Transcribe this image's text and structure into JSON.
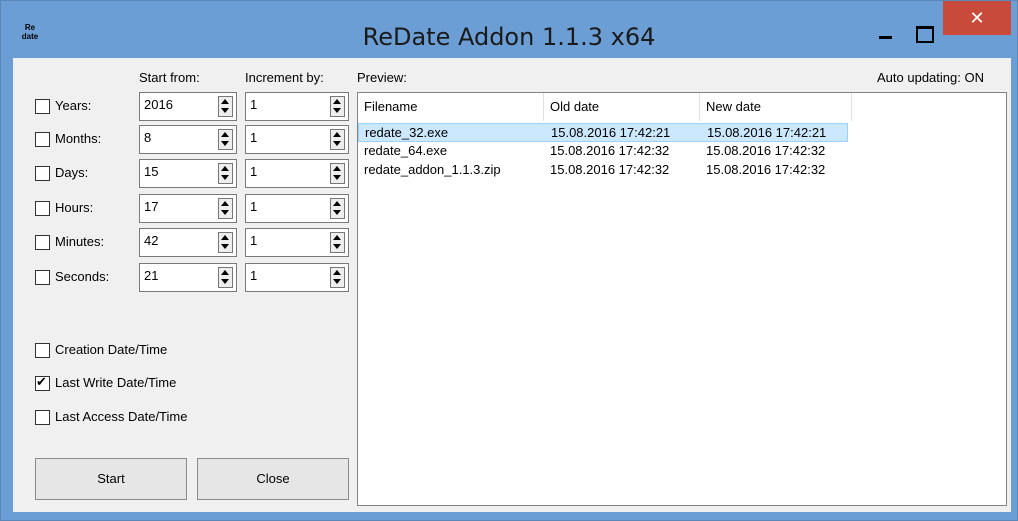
{
  "window": {
    "icon_text": "Re date",
    "title": "ReDate Addon 1.1.3 x64",
    "close_glyph": "✕"
  },
  "headers": {
    "start_from": "Start from:",
    "increment_by": "Increment by:",
    "preview": "Preview:",
    "auto_updating": "Auto updating: ON"
  },
  "fields": [
    {
      "label": "Years:",
      "start": "2016",
      "increment": "1",
      "checked": false
    },
    {
      "label": "Months:",
      "start": "8",
      "increment": "1",
      "checked": false
    },
    {
      "label": "Days:",
      "start": "15",
      "increment": "1",
      "checked": false
    },
    {
      "label": "Hours:",
      "start": "17",
      "increment": "1",
      "checked": false
    },
    {
      "label": "Minutes:",
      "start": "42",
      "increment": "1",
      "checked": false
    },
    {
      "label": "Seconds:",
      "start": "21",
      "increment": "1",
      "checked": false
    }
  ],
  "options": [
    {
      "label": "Creation Date/Time",
      "checked": false
    },
    {
      "label": "Last Write Date/Time",
      "checked": true
    },
    {
      "label": "Last Access Date/Time",
      "checked": false
    }
  ],
  "buttons": {
    "start": "Start",
    "close": "Close"
  },
  "table": {
    "columns": [
      "Filename",
      "Old date",
      "New date"
    ],
    "rows": [
      [
        "redate_32.exe",
        "15.08.2016 17:42:21",
        "15.08.2016 17:42:21"
      ],
      [
        "redate_64.exe",
        "15.08.2016 17:42:32",
        "15.08.2016 17:42:32"
      ],
      [
        "redate_addon_1.1.3.zip",
        "15.08.2016 17:42:32",
        "15.08.2016 17:42:32"
      ]
    ]
  }
}
